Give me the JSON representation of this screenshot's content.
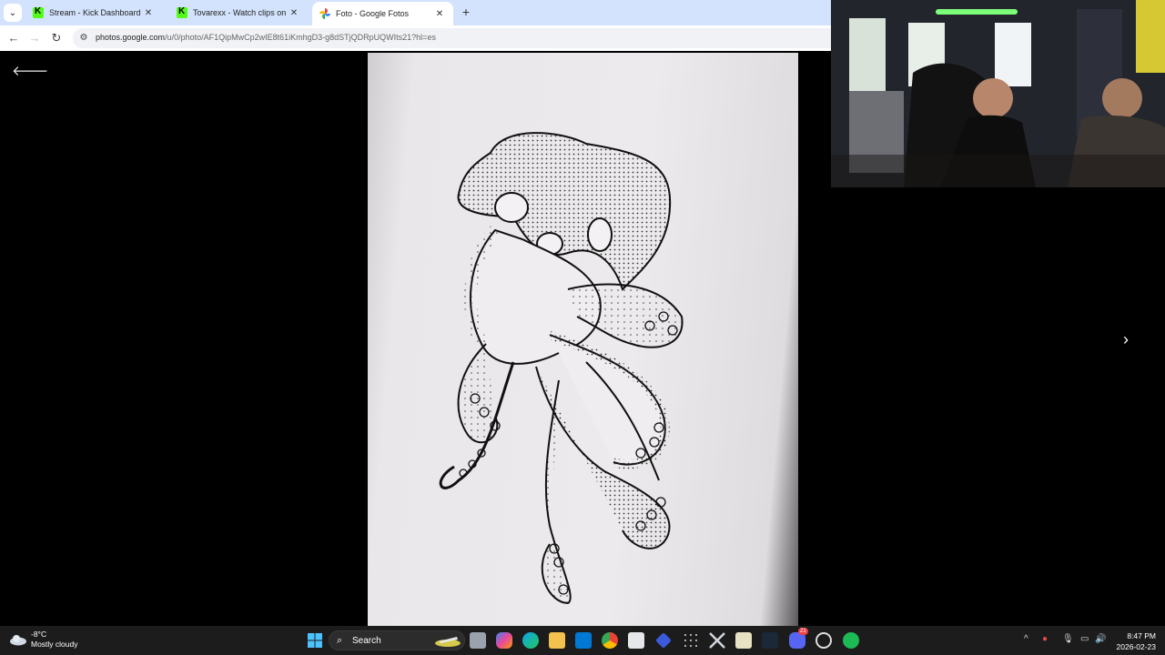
{
  "browser": {
    "tabs": [
      {
        "label": "Stream - Kick Dashboard",
        "favicon": "kick-icon"
      },
      {
        "label": "Tovarexx - Watch clips on Kick",
        "favicon": "kick-icon"
      },
      {
        "label": "Foto - Google Fotos",
        "favicon": "google-photos-icon",
        "active": true
      }
    ],
    "url_host": "photos.google.com",
    "url_path": "/u/0/photo/AF1QipMwCp2wIE8t61iKmhgD3-g8dSTjQDRpUQWIts21?hl=es"
  },
  "photo_viewer": {
    "subject": "octopus drawing"
  },
  "taskbar": {
    "weather_temp": "-8°C",
    "weather_desc": "Mostly cloudy",
    "search_label": "Search",
    "time": "8:47 PM",
    "date": "2026-02-23",
    "discord_badge": "21"
  },
  "colors": {
    "kick_green": "#53fc18",
    "tabstrip": "#d3e3fd",
    "taskbar": "#1c1c1c"
  }
}
